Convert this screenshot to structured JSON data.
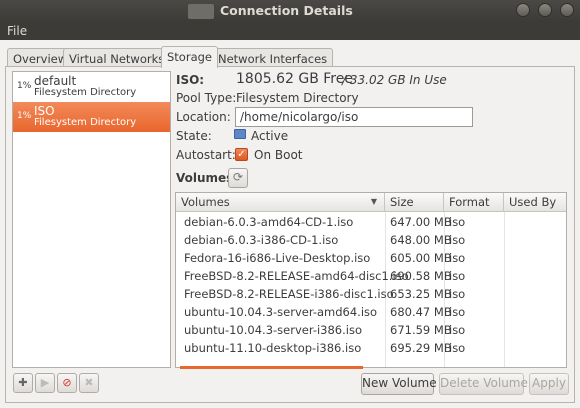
{
  "window": {
    "title": "Connection Details"
  },
  "menubar": {
    "file_label": "File"
  },
  "tabs": [
    {
      "label": "Overview",
      "active": false
    },
    {
      "label": "Virtual Networks",
      "active": false
    },
    {
      "label": "Storage",
      "active": true
    },
    {
      "label": "Network Interfaces",
      "active": false
    }
  ],
  "pools": [
    {
      "percent": "1%",
      "name": "default",
      "type": "Filesystem Directory",
      "selected": false
    },
    {
      "percent": "1%",
      "name": "ISO",
      "type": "Filesystem Directory",
      "selected": true
    }
  ],
  "details": {
    "name_label": "ISO:",
    "free": "1805.62 GB Free",
    "in_use": " / 33.02 GB In Use",
    "pool_type_label": "Pool Type:",
    "pool_type_value": "Filesystem Directory",
    "location_label": "Location:",
    "location_value": "/home/nicolargo/iso",
    "state_label": "State:",
    "state_value": "Active",
    "autostart_label": "Autostart:",
    "autostart_value": "On Boot",
    "autostart_checked": true
  },
  "volumes": {
    "section_label": "Volumes",
    "columns": [
      "Volumes",
      "Size",
      "Format",
      "Used By"
    ],
    "rows": [
      {
        "name": "debian-6.0.3-amd64-CD-1.iso",
        "size": "647.00 MB",
        "format": "iso",
        "used_by": ""
      },
      {
        "name": "debian-6.0.3-i386-CD-1.iso",
        "size": "648.00 MB",
        "format": "iso",
        "used_by": ""
      },
      {
        "name": "Fedora-16-i686-Live-Desktop.iso",
        "size": "605.00 MB",
        "format": "iso",
        "used_by": ""
      },
      {
        "name": "FreeBSD-8.2-RELEASE-amd64-disc1.iso",
        "size": "690.58 MB",
        "format": "iso",
        "used_by": ""
      },
      {
        "name": "FreeBSD-8.2-RELEASE-i386-disc1.iso",
        "size": "653.25 MB",
        "format": "iso",
        "used_by": ""
      },
      {
        "name": "ubuntu-10.04.3-server-amd64.iso",
        "size": "680.47 MB",
        "format": "iso",
        "used_by": ""
      },
      {
        "name": "ubuntu-10.04.3-server-i386.iso",
        "size": "671.59 MB",
        "format": "iso",
        "used_by": ""
      },
      {
        "name": "ubuntu-11.10-desktop-i386.iso",
        "size": "695.29 MB",
        "format": "iso",
        "used_by": ""
      }
    ]
  },
  "buttons": {
    "new_volume": "New Volume",
    "delete_volume": "Delete Volume",
    "apply": "Apply"
  },
  "icons": {
    "add": "add-icon",
    "start": "play-icon",
    "stop": "stop-icon",
    "delete": "delete-icon",
    "refresh": "refresh-icon",
    "state": "state-icon"
  },
  "colors": {
    "accent": "#e9662d",
    "titlebar": "#3c3b37"
  }
}
